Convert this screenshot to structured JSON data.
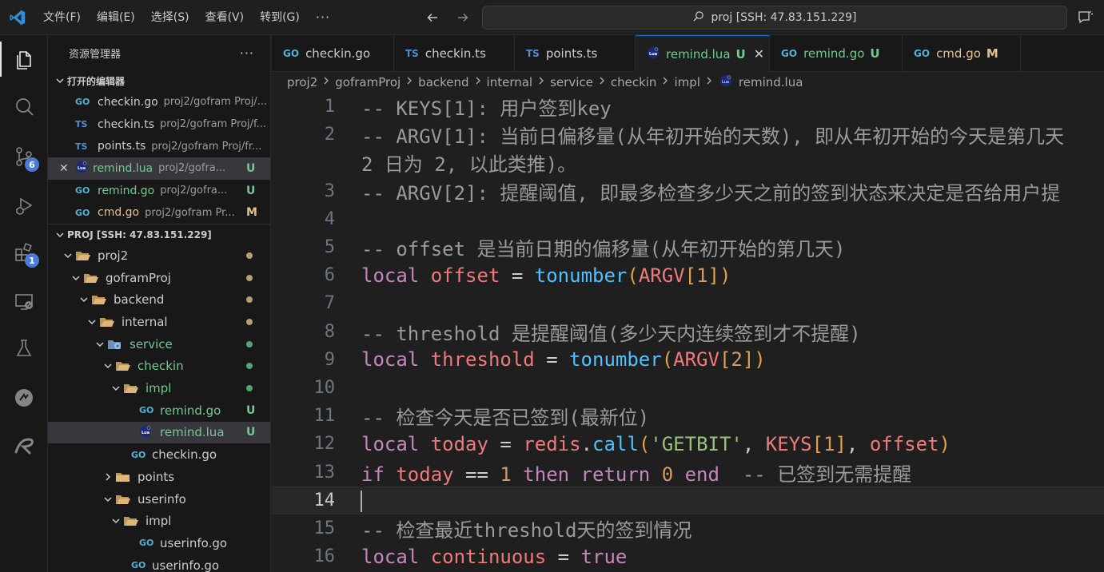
{
  "titlebar": {
    "menus": [
      "文件(F)",
      "编辑(E)",
      "选择(S)",
      "查看(V)",
      "转到(G)"
    ],
    "more": "···",
    "search": "proj [SSH: 47.83.151.229]"
  },
  "activitybar": {
    "items": [
      "explorer-icon",
      "search-icon",
      "source-control-icon",
      "run-debug-icon",
      "extensions-icon",
      "remote-explorer-icon",
      "testing-icon",
      "gitlens-icon",
      "remote-r-icon"
    ],
    "source_control_badge": "6",
    "extensions_badge": "1"
  },
  "sidebar": {
    "title": "资源管理器",
    "more": "···",
    "open_editors_title": "打开的编辑器",
    "open_editors": [
      {
        "type": "GO",
        "name": "checkin.go",
        "path": "proj2/gofram Proj/...",
        "status": ""
      },
      {
        "type": "TS",
        "name": "checkin.ts",
        "path": "proj2/gofram Proj/f...",
        "status": ""
      },
      {
        "type": "TS",
        "name": "points.ts",
        "path": "proj2/gofram Proj/fr...",
        "status": ""
      },
      {
        "type": "LUA",
        "name": "remind.lua",
        "path": "proj2/gofra...",
        "status": "U"
      },
      {
        "type": "GO",
        "name": "remind.go",
        "path": "proj2/gofra...",
        "status": "U"
      },
      {
        "type": "GO",
        "name": "cmd.go",
        "path": "proj2/gofram Pr...",
        "status": "M"
      }
    ],
    "project_title": "PROJ [SSH: 47.83.151.229]",
    "tree": [
      {
        "name": "proj2",
        "kind": "folder",
        "open": true,
        "depth": 0,
        "dot": "y",
        "status": ""
      },
      {
        "name": "goframProj",
        "kind": "folder",
        "open": true,
        "depth": 1,
        "dot": "y",
        "status": ""
      },
      {
        "name": "backend",
        "kind": "folder",
        "open": true,
        "depth": 2,
        "dot": "y",
        "status": ""
      },
      {
        "name": "internal",
        "kind": "folder",
        "open": true,
        "depth": 3,
        "dot": "y",
        "status": ""
      },
      {
        "name": "service",
        "kind": "service-folder",
        "open": true,
        "depth": 4,
        "dot": "g",
        "status": ""
      },
      {
        "name": "checkin",
        "kind": "folder",
        "open": true,
        "depth": 5,
        "dot": "g",
        "status": ""
      },
      {
        "name": "impl",
        "kind": "folder",
        "open": true,
        "depth": 6,
        "dot": "g",
        "status": ""
      },
      {
        "name": "remind.go",
        "kind": "go",
        "depth": 7,
        "status": "U"
      },
      {
        "name": "remind.lua",
        "kind": "lua",
        "depth": 7,
        "status": "U"
      },
      {
        "name": "checkin.go",
        "kind": "go",
        "depth": 6,
        "status": ""
      },
      {
        "name": "points",
        "kind": "folder",
        "open": false,
        "depth": 5,
        "status": ""
      },
      {
        "name": "userinfo",
        "kind": "folder",
        "open": true,
        "depth": 5,
        "status": ""
      },
      {
        "name": "impl",
        "kind": "folder",
        "open": true,
        "depth": 6,
        "status": ""
      },
      {
        "name": "userinfo.go",
        "kind": "go",
        "depth": 7,
        "status": ""
      },
      {
        "name": "userinfo.go",
        "kind": "go",
        "depth": 6,
        "status": ""
      }
    ]
  },
  "tabs": [
    {
      "type": "GO",
      "name": "checkin.go",
      "status": "",
      "active": false,
      "width": 153
    },
    {
      "type": "TS",
      "name": "checkin.ts",
      "status": "",
      "active": false,
      "width": 151
    },
    {
      "type": "TS",
      "name": "points.ts",
      "status": "",
      "active": false,
      "width": 151
    },
    {
      "type": "LUA",
      "name": "remind.lua",
      "status": "U",
      "active": true,
      "width": 168
    },
    {
      "type": "GO",
      "name": "remind.go",
      "status": "U",
      "active": false,
      "width": 166
    },
    {
      "type": "GO",
      "name": "cmd.go",
      "status": "M",
      "active": false,
      "width": 148
    }
  ],
  "breadcrumb": [
    "proj2",
    "goframProj",
    "backend",
    "internal",
    "service",
    "checkin",
    "impl",
    "remind.lua"
  ],
  "editor": {
    "current_line": "14",
    "lines": [
      {
        "n": "1",
        "tokens": [
          [
            "cmt",
            "-- KEYS[1]: 用户签到key"
          ]
        ]
      },
      {
        "n": "2",
        "tokens": [
          [
            "cmt",
            "-- ARGV[1]: 当前日偏移量(从年初开始的天数), 即从年初开始的今天是第几天"
          ]
        ]
      },
      {
        "n": "",
        "tokens": [
          [
            "cmt",
            "2 日为 2, 以此类推)。"
          ]
        ]
      },
      {
        "n": "3",
        "tokens": [
          [
            "cmt",
            "-- ARGV[2]: 提醒阈值, 即最多检查多少天之前的签到状态来决定是否给用户提"
          ]
        ]
      },
      {
        "n": "4",
        "tokens": []
      },
      {
        "n": "5",
        "tokens": [
          [
            "cmt",
            "-- offset 是当前日期的偏移量(从年初开始的第几天)"
          ]
        ]
      },
      {
        "n": "6",
        "tokens": [
          [
            "kw",
            "local "
          ],
          [
            "var",
            "offset"
          ],
          [
            "plain",
            " = "
          ],
          [
            "fn",
            "tonumber"
          ],
          [
            "br",
            "("
          ],
          [
            "var",
            "ARGV"
          ],
          [
            "br",
            "["
          ],
          [
            "num",
            "1"
          ],
          [
            "br",
            "])"
          ]
        ]
      },
      {
        "n": "7",
        "tokens": []
      },
      {
        "n": "8",
        "tokens": [
          [
            "cmt",
            "-- threshold 是提醒阈值(多少天内连续签到才不提醒)"
          ]
        ]
      },
      {
        "n": "9",
        "tokens": [
          [
            "kw",
            "local "
          ],
          [
            "var",
            "threshold"
          ],
          [
            "plain",
            " = "
          ],
          [
            "fn",
            "tonumber"
          ],
          [
            "br",
            "("
          ],
          [
            "var",
            "ARGV"
          ],
          [
            "br",
            "["
          ],
          [
            "num",
            "2"
          ],
          [
            "br",
            "])"
          ]
        ]
      },
      {
        "n": "10",
        "tokens": []
      },
      {
        "n": "11",
        "tokens": [
          [
            "cmt",
            "-- 检查今天是否已签到(最新位)"
          ]
        ]
      },
      {
        "n": "12",
        "tokens": [
          [
            "kw",
            "local "
          ],
          [
            "var",
            "today"
          ],
          [
            "plain",
            " = "
          ],
          [
            "var",
            "redis"
          ],
          [
            "plain",
            "."
          ],
          [
            "fn",
            "call"
          ],
          [
            "br",
            "("
          ],
          [
            "str",
            "'GETBIT'"
          ],
          [
            "plain",
            ", "
          ],
          [
            "var",
            "KEYS"
          ],
          [
            "br",
            "["
          ],
          [
            "num",
            "1"
          ],
          [
            "br",
            "]"
          ],
          [
            "plain",
            ", "
          ],
          [
            "var",
            "offset"
          ],
          [
            "br",
            ")"
          ]
        ]
      },
      {
        "n": "13",
        "tokens": [
          [
            "kw",
            "if "
          ],
          [
            "var",
            "today"
          ],
          [
            "plain",
            " == "
          ],
          [
            "num",
            "1"
          ],
          [
            "kw",
            " then return "
          ],
          [
            "num",
            "0"
          ],
          [
            "kw",
            " end"
          ],
          [
            "cmt",
            "  -- 已签到无需提醒"
          ]
        ]
      },
      {
        "n": "14",
        "tokens": []
      },
      {
        "n": "15",
        "tokens": [
          [
            "cmt",
            "-- 检查最近threshold天的签到情况"
          ]
        ]
      },
      {
        "n": "16",
        "tokens": [
          [
            "kw",
            "local "
          ],
          [
            "var",
            "continuous"
          ],
          [
            "plain",
            " = "
          ],
          [
            "kw",
            "true"
          ]
        ]
      }
    ]
  }
}
